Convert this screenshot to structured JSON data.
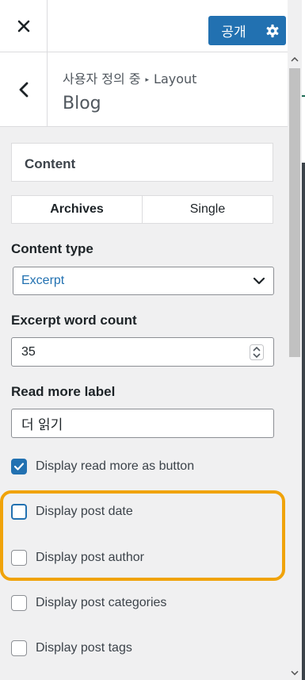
{
  "topbar": {
    "publish_label": "공개"
  },
  "header": {
    "breadcrumb_parent": "사용자 정의 중",
    "breadcrumb_section": "Layout",
    "title": "Blog"
  },
  "section": {
    "title": "Content"
  },
  "tabs": [
    {
      "label": "Archives",
      "active": true
    },
    {
      "label": "Single",
      "active": false
    }
  ],
  "content_type": {
    "label": "Content type",
    "value": "Excerpt"
  },
  "excerpt_count": {
    "label": "Excerpt word count",
    "value": "35"
  },
  "read_more": {
    "label": "Read more label",
    "value": "더 읽기"
  },
  "checkboxes": [
    {
      "label": "Display read more as button",
      "checked": true
    },
    {
      "label": "Display post date",
      "checked": false
    },
    {
      "label": "Display post author",
      "checked": false
    },
    {
      "label": "Display post categories",
      "checked": false
    },
    {
      "label": "Display post tags",
      "checked": false
    }
  ],
  "colors": {
    "accent": "#2271b1",
    "highlight": "#f0a30a"
  },
  "icons": {
    "close": "close-icon",
    "gear": "gear-icon",
    "back": "chevron-left-icon",
    "dropdown": "chevron-down-icon"
  }
}
